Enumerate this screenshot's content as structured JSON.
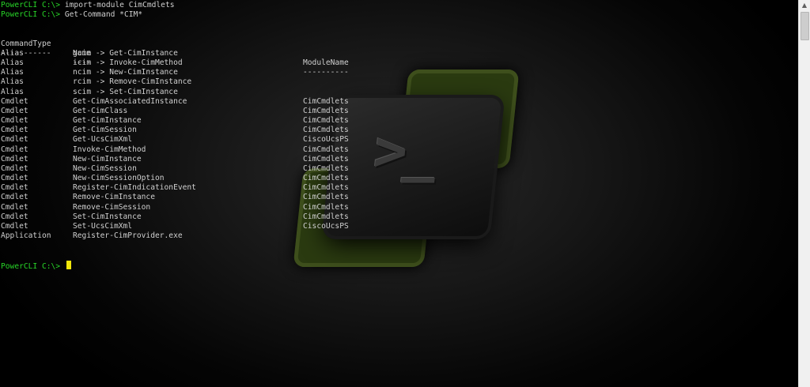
{
  "prompt": "PowerCLI C:\\>",
  "commands": [
    "import-module CimCmdlets",
    "Get-Command *CIM*"
  ],
  "table": {
    "headers": [
      "CommandType",
      "Name",
      "ModuleName"
    ],
    "separators": [
      "-----------",
      "----",
      "----------"
    ],
    "rows": [
      [
        "Alias",
        "gcim -> Get-CimInstance",
        ""
      ],
      [
        "Alias",
        "icim -> Invoke-CimMethod",
        ""
      ],
      [
        "Alias",
        "ncim -> New-CimInstance",
        ""
      ],
      [
        "Alias",
        "rcim -> Remove-CimInstance",
        ""
      ],
      [
        "Alias",
        "scim -> Set-CimInstance",
        ""
      ],
      [
        "Cmdlet",
        "Get-CimAssociatedInstance",
        "CimCmdlets"
      ],
      [
        "Cmdlet",
        "Get-CimClass",
        "CimCmdlets"
      ],
      [
        "Cmdlet",
        "Get-CimInstance",
        "CimCmdlets"
      ],
      [
        "Cmdlet",
        "Get-CimSession",
        "CimCmdlets"
      ],
      [
        "Cmdlet",
        "Get-UcsCimXml",
        "CiscoUcsPS"
      ],
      [
        "Cmdlet",
        "Invoke-CimMethod",
        "CimCmdlets"
      ],
      [
        "Cmdlet",
        "New-CimInstance",
        "CimCmdlets"
      ],
      [
        "Cmdlet",
        "New-CimSession",
        "CimCmdlets"
      ],
      [
        "Cmdlet",
        "New-CimSessionOption",
        "CimCmdlets"
      ],
      [
        "Cmdlet",
        "Register-CimIndicationEvent",
        "CimCmdlets"
      ],
      [
        "Cmdlet",
        "Remove-CimInstance",
        "CimCmdlets"
      ],
      [
        "Cmdlet",
        "Remove-CimSession",
        "CimCmdlets"
      ],
      [
        "Cmdlet",
        "Set-CimInstance",
        "CimCmdlets"
      ],
      [
        "Cmdlet",
        "Set-UcsCimXml",
        "CiscoUcsPS"
      ],
      [
        "Application",
        "Register-CimProvider.exe",
        ""
      ]
    ]
  },
  "colors": {
    "prompt": "#28d628",
    "text": "#cfcfcf",
    "cursor": "#f2e60a",
    "background": "#000000"
  },
  "icons": {
    "logo": "powershell-logo-icon",
    "glyph": ">_",
    "scroll_up": "chevron-up-icon"
  }
}
